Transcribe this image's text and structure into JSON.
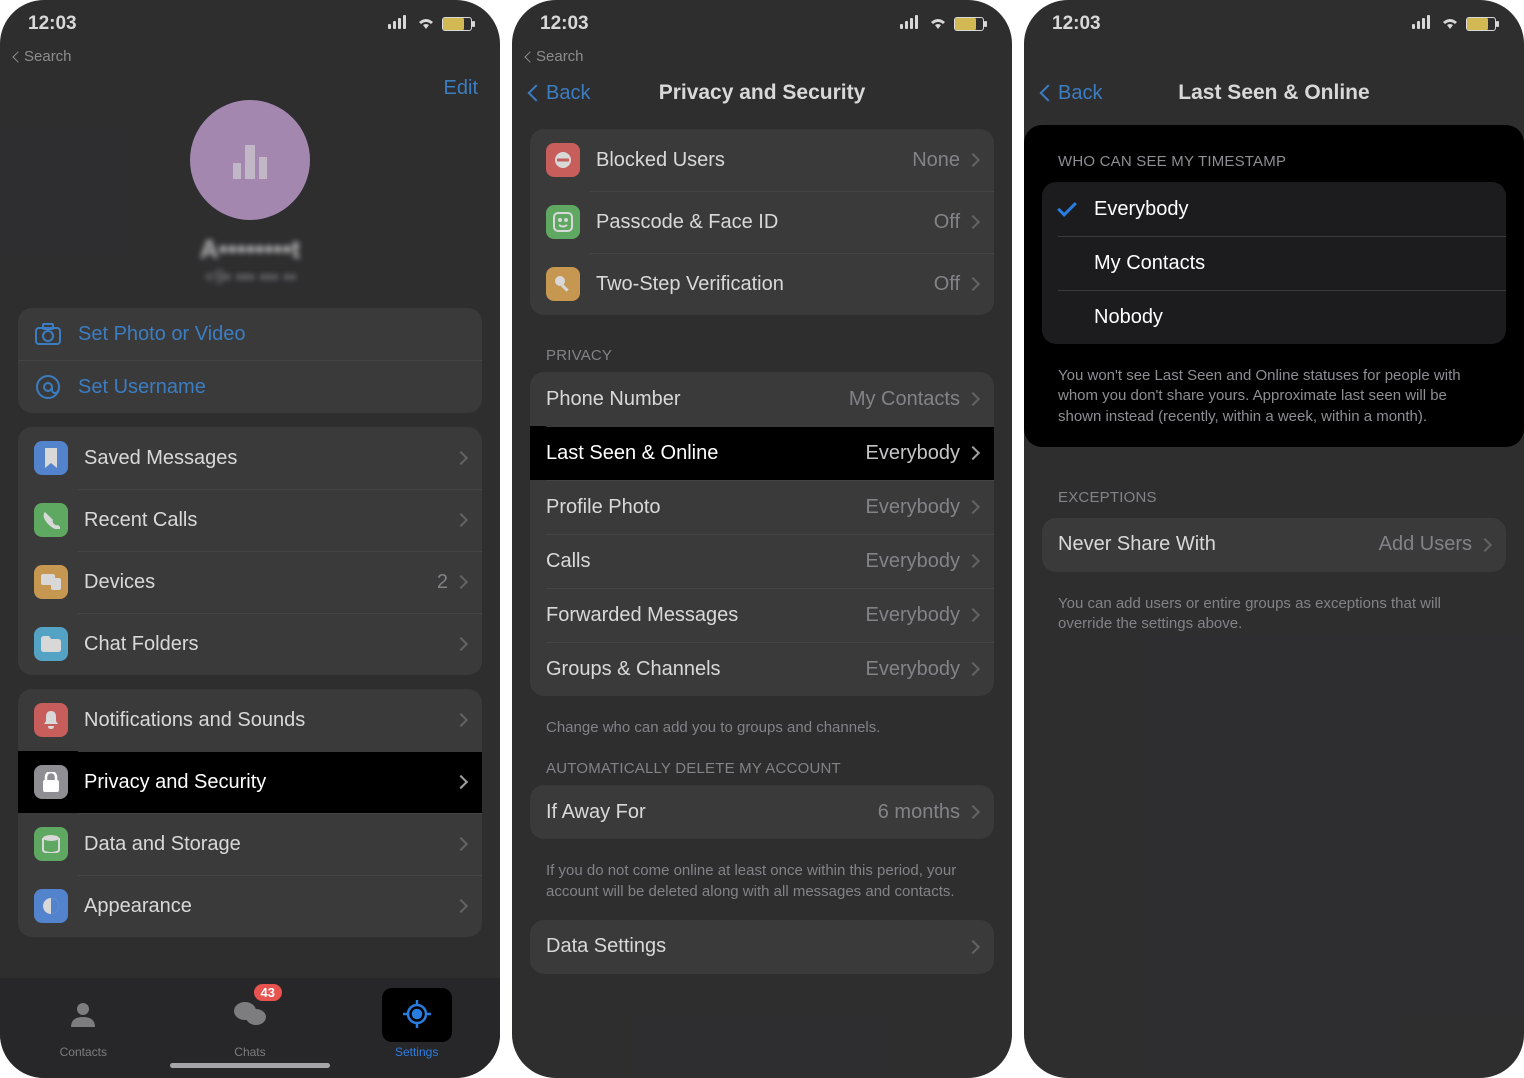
{
  "status": {
    "time": "12:03",
    "back_crumb": "Search"
  },
  "screen1": {
    "edit": "Edit",
    "profile": {
      "name": "A••••••••t",
      "phone": "+9• ••• ••• ••"
    },
    "actions": {
      "set_photo": "Set Photo or Video",
      "set_username": "Set Username"
    },
    "group_a": {
      "saved_messages": "Saved Messages",
      "recent_calls": "Recent Calls",
      "devices": "Devices",
      "devices_value": "2",
      "chat_folders": "Chat Folders"
    },
    "group_b": {
      "notifications": "Notifications and Sounds",
      "privacy": "Privacy and Security",
      "data_storage": "Data and Storage",
      "appearance": "Appearance"
    },
    "tabs": {
      "contacts": "Contacts",
      "chats": "Chats",
      "chats_badge": "43",
      "settings": "Settings"
    }
  },
  "screen2": {
    "back": "Back",
    "title": "Privacy and Security",
    "security": {
      "blocked": "Blocked Users",
      "blocked_value": "None",
      "passcode": "Passcode & Face ID",
      "passcode_value": "Off",
      "twostep": "Two-Step Verification",
      "twostep_value": "Off"
    },
    "privacy_header": "PRIVACY",
    "privacy": {
      "phone_number": "Phone Number",
      "phone_number_value": "My Contacts",
      "last_seen": "Last Seen & Online",
      "last_seen_value": "Everybody",
      "profile_photo": "Profile Photo",
      "profile_photo_value": "Everybody",
      "calls": "Calls",
      "calls_value": "Everybody",
      "forwarded": "Forwarded Messages",
      "forwarded_value": "Everybody",
      "groups": "Groups & Channels",
      "groups_value": "Everybody"
    },
    "privacy_footer": "Change who can add you to groups and channels.",
    "autodelete_header": "AUTOMATICALLY DELETE MY ACCOUNT",
    "autodelete": {
      "if_away": "If Away For",
      "if_away_value": "6 months"
    },
    "autodelete_footer": "If you do not come online at least once within this period, your account will be deleted along with all messages and contacts.",
    "data_settings": "Data Settings"
  },
  "screen3": {
    "back": "Back",
    "title": "Last Seen & Online",
    "timestamp_header": "WHO CAN SEE MY TIMESTAMP",
    "options": {
      "everybody": "Everybody",
      "my_contacts": "My Contacts",
      "nobody": "Nobody"
    },
    "timestamp_footer": "You won't see Last Seen and Online statuses for people with whom you don't share yours. Approximate last seen will be shown instead (recently, within a week, within a month).",
    "exceptions_header": "EXCEPTIONS",
    "never_share": "Never Share With",
    "never_share_value": "Add Users",
    "exceptions_footer": "You can add users or entire groups as exceptions that will override the settings above."
  }
}
